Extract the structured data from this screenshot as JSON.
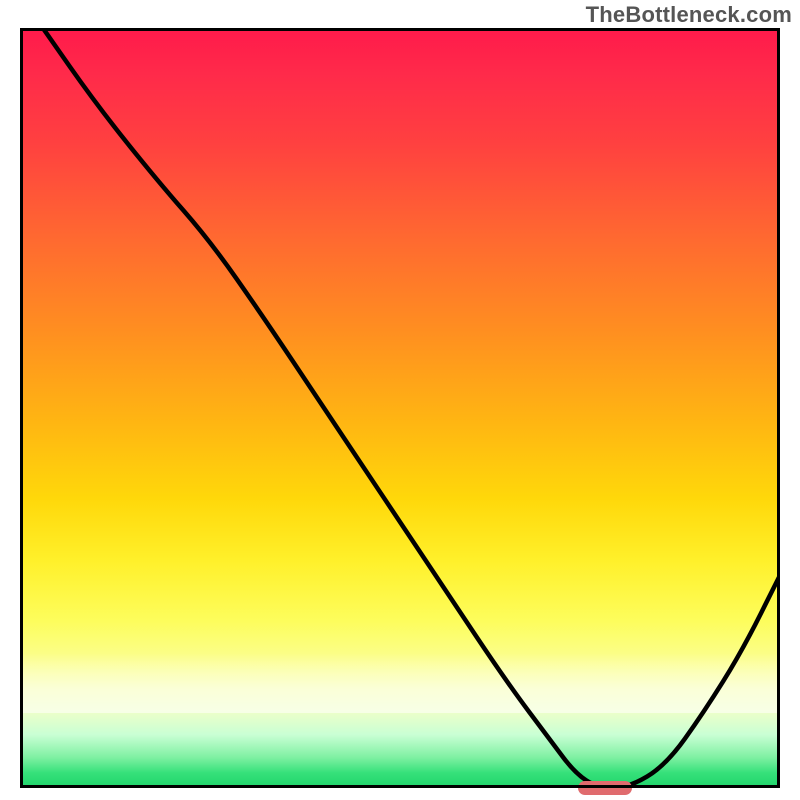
{
  "watermark": "TheBottleneck.com",
  "chart_data": {
    "type": "line",
    "title": "",
    "xlabel": "",
    "ylabel": "",
    "xlim": [
      0,
      100
    ],
    "ylim": [
      0,
      100
    ],
    "grid": false,
    "legend": null,
    "series": [
      {
        "name": "bottleneck-curve",
        "x": [
          3,
          10,
          18,
          25,
          32,
          40,
          48,
          56,
          64,
          70,
          73,
          76,
          80,
          85,
          90,
          95,
          100
        ],
        "values": [
          100,
          90,
          80,
          72,
          62,
          50,
          38,
          26,
          14,
          6,
          2,
          0,
          0,
          3,
          10,
          18,
          28
        ]
      }
    ],
    "annotations": [
      {
        "name": "optimal-marker",
        "x": 77,
        "y": 0,
        "shape": "pill",
        "color": "#e06b6e"
      }
    ],
    "background": {
      "type": "vertical-gradient",
      "stops": [
        {
          "pos": 0.0,
          "color": "#ff1a4b"
        },
        {
          "pos": 0.5,
          "color": "#ffb612"
        },
        {
          "pos": 0.78,
          "color": "#fdfd5c"
        },
        {
          "pos": 0.93,
          "color": "#c9ffd4"
        },
        {
          "pos": 1.0,
          "color": "#1fd36a"
        }
      ]
    }
  }
}
